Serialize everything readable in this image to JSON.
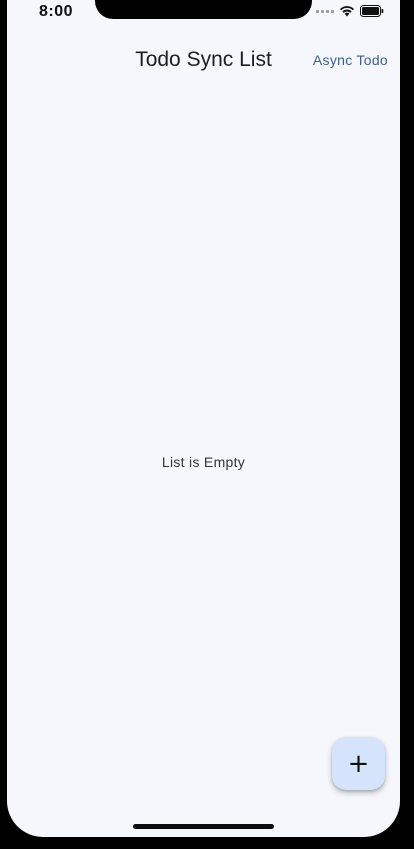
{
  "status_bar": {
    "time": "8:00"
  },
  "app_bar": {
    "title": "Todo Sync List",
    "action_label": "Async Todo"
  },
  "body": {
    "empty_message": "List is Empty"
  },
  "fab": {
    "icon": "plus-icon",
    "glyph": "+"
  },
  "colors": {
    "background": "#f6f7fd",
    "accent_text": "#3d5f8a",
    "fab_background": "#d6e4fb"
  }
}
